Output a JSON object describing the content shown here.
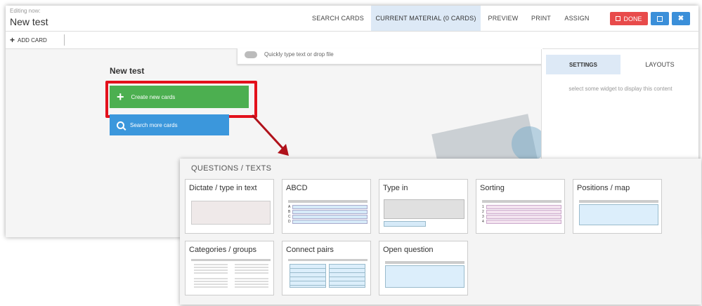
{
  "header": {
    "editing_label": "Editing now:",
    "title": "New test",
    "nav": [
      "SEARCH CARDS",
      "CURRENT MATERIAL (0 CARDS)",
      "PREVIEW",
      "PRINT",
      "ASSIGN"
    ],
    "active_nav_index": 1,
    "done_label": "DONE",
    "save_icon": "floppy-icon",
    "close_icon": "close-icon"
  },
  "toolbar": {
    "add_card_label": "ADD CARD"
  },
  "dropzone": {
    "placeholder": "Quickly type text or drop file"
  },
  "material": {
    "title": "New test",
    "create_label": "Create new cards",
    "search_label": "Search more cards"
  },
  "panel": {
    "tabs": [
      "SETTINGS",
      "LAYOUTS"
    ],
    "hint": "select some widget to display this content"
  },
  "popup": {
    "title": "QUESTIONS / TEXTS",
    "types": [
      "Dictate / type in text",
      "ABCD",
      "Type in",
      "Sorting",
      "Positions / map",
      "Categories / groups",
      "Connect pairs",
      "Open question"
    ],
    "abcd_letters": [
      "A",
      "B",
      "C",
      "D"
    ],
    "sorting_numbers": [
      "1",
      "2",
      "3",
      "4"
    ]
  },
  "colors": {
    "accent_blue": "#3b97dc",
    "create_green": "#4caf50",
    "done_red": "#e84b4b",
    "highlight_red": "#e3111c",
    "active_tab": "#dde9f6"
  }
}
